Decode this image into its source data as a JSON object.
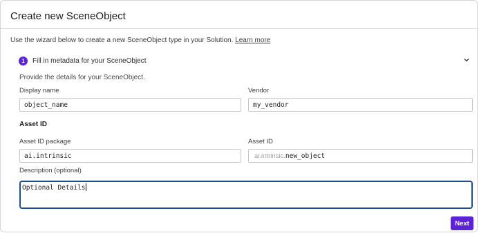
{
  "dialog": {
    "title": "Create new SceneObject",
    "intro_text": "Use the wizard below to create a new SceneObject type in your Solution.",
    "learn_more": "Learn more"
  },
  "step": {
    "number": "1",
    "title": "Fill in metadata for your SceneObject",
    "description": "Provide the details for your SceneObject.",
    "icon": "chevron-down-icon"
  },
  "fields": {
    "display_name_label": "Display name",
    "display_name_value": "object_name",
    "vendor_label": "Vendor",
    "vendor_value": "my_vendor",
    "asset_section": "Asset ID",
    "asset_package_label": "Asset ID package",
    "asset_package_value": "ai.intrinsic",
    "asset_id_label": "Asset ID",
    "asset_id_prefix": "ai.intrinsic.",
    "asset_id_value": "new_object",
    "description_label": "Description (optional)",
    "description_value": "Optional Details"
  },
  "actions": {
    "next_label": "Next"
  },
  "colors": {
    "accent": "#5b22d6",
    "focus_border": "#1e4f8a"
  }
}
